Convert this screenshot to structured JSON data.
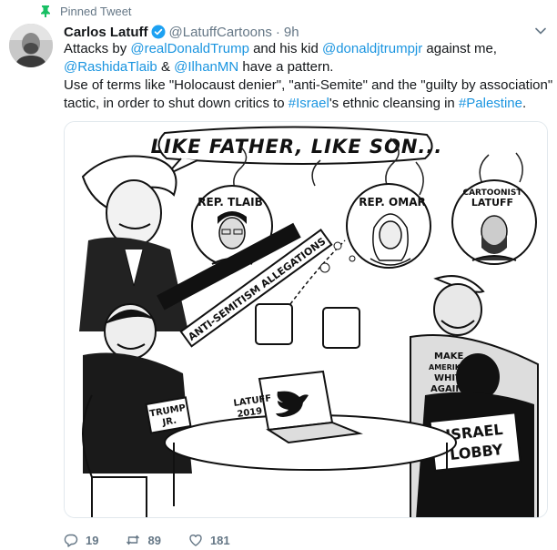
{
  "pinned": {
    "label": "Pinned Tweet",
    "icon": "pin-icon"
  },
  "author": {
    "name": "Carlos Latuff",
    "handle": "@LatuffCartoons",
    "separator": "·",
    "time": "9h",
    "verified_icon": "verified-badge-icon"
  },
  "tweet": {
    "line1": {
      "prefix": "Attacks by ",
      "mention1": "@realDonaldTrump",
      "mid": " and his kid ",
      "mention2": "@donaldjtrumpjr",
      "suffix": " against me,"
    },
    "line2": {
      "mention1": "@RashidaTlaib",
      "mid": " & ",
      "mention2": "@IlhanMN",
      "suffix": " have a pattern."
    },
    "line3": "Use of terms like \"Holocaust denier\", \"anti-Semite\" and the \"guilty by association\"",
    "line4": {
      "prefix": "tactic, in order to shut down critics to ",
      "hashtag1": "#Israel",
      "mid": "'s ethnic cleansing in ",
      "hashtag2": "#Palestine",
      "suffix": "."
    }
  },
  "cartoon": {
    "speech": "LIKE FATHER, LIKE SON...",
    "tlaib_label": "REP. TLAIB",
    "omar_label": "REP. OMAR",
    "latuff_label": [
      "CARTOONIST",
      "LATUFF"
    ],
    "jr_label": [
      "TRUMP",
      "JR."
    ],
    "mug_label": "ANTI-SEMITISM ALLEGATIONS",
    "signature": [
      "LATUFF",
      "2019"
    ],
    "hat_text": [
      "MAKE",
      "AMERIKKKA",
      "WHITE",
      "AGAIN!"
    ],
    "lobby_text": [
      "ISRAEL",
      "LOBBY"
    ]
  },
  "actions": {
    "reply": {
      "icon": "reply-icon",
      "count": "19"
    },
    "retweet": {
      "icon": "retweet-icon",
      "count": "89"
    },
    "like": {
      "icon": "like-icon",
      "count": "181"
    }
  },
  "colors": {
    "accent": "#1b95e0",
    "pin_green": "#17bf63",
    "muted": "#657786",
    "text": "#14171a"
  }
}
